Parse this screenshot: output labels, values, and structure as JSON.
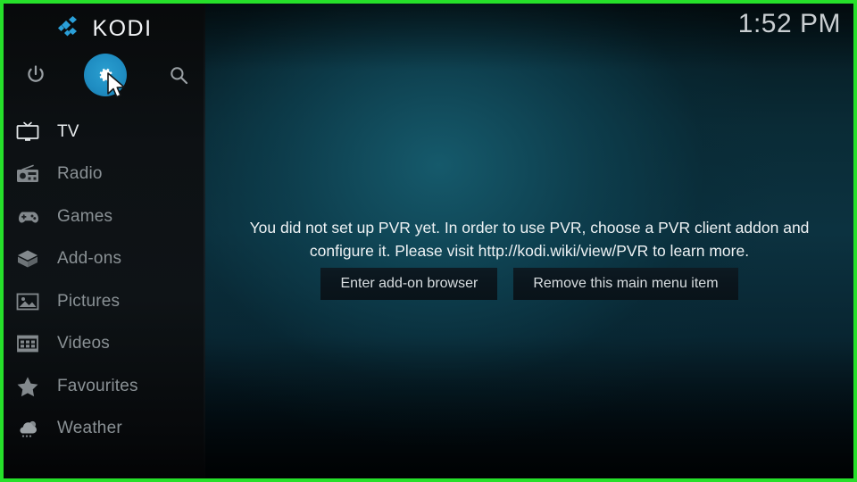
{
  "app": {
    "name": "KODI",
    "logo_icon": "kodi-logo-icon",
    "accent_color": "#1f8dc2",
    "border_color": "#26e02a"
  },
  "header": {
    "clock": "1:52 PM"
  },
  "toolbar": {
    "items": [
      {
        "name": "power",
        "icon": "power-icon",
        "label": "Power",
        "active": false
      },
      {
        "name": "settings",
        "icon": "gear-icon",
        "label": "Settings",
        "active": true
      },
      {
        "name": "search",
        "icon": "search-icon",
        "label": "Search",
        "active": false
      }
    ],
    "cursor_icon": "mouse-pointer-icon"
  },
  "sidebar": {
    "items": [
      {
        "label": "TV",
        "icon": "tv-icon",
        "active": true
      },
      {
        "label": "Radio",
        "icon": "radio-icon",
        "active": false
      },
      {
        "label": "Games",
        "icon": "gamepad-icon",
        "active": false
      },
      {
        "label": "Add-ons",
        "icon": "addon-box-icon",
        "active": false
      },
      {
        "label": "Pictures",
        "icon": "picture-icon",
        "active": false
      },
      {
        "label": "Videos",
        "icon": "film-icon",
        "active": false
      },
      {
        "label": "Favourites",
        "icon": "star-icon",
        "active": false
      },
      {
        "label": "Weather",
        "icon": "cloud-sun-icon",
        "active": false
      }
    ]
  },
  "main": {
    "message": "You did not set up PVR yet. In order to use PVR, choose a PVR client addon and configure it. Please visit http://kodi.wiki/view/PVR to learn more.",
    "buttons": [
      {
        "label": "Enter add-on browser"
      },
      {
        "label": "Remove this main menu item"
      }
    ]
  }
}
